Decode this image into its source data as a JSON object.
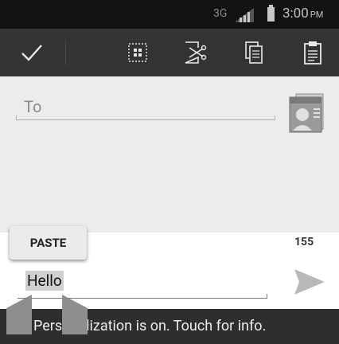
{
  "status_bar": {
    "network": "3G",
    "time": "3:00",
    "ampm": "PM"
  },
  "action_bar": {
    "buttons": [
      {
        "name": "done",
        "icon": "checkmark-icon"
      },
      {
        "name": "select-all",
        "icon": "select-all-icon"
      },
      {
        "name": "cut",
        "icon": "cut-icon"
      },
      {
        "name": "copy",
        "icon": "copy-icon"
      },
      {
        "name": "paste",
        "icon": "clipboard-paste-icon"
      }
    ]
  },
  "compose": {
    "to_placeholder": "To",
    "contact_icon": "contact-card-icon"
  },
  "paste_popup": {
    "label": "PASTE"
  },
  "message": {
    "text": "Hello",
    "char_counter": "155"
  },
  "toast": {
    "text": "Personalization is on. Touch for info."
  }
}
